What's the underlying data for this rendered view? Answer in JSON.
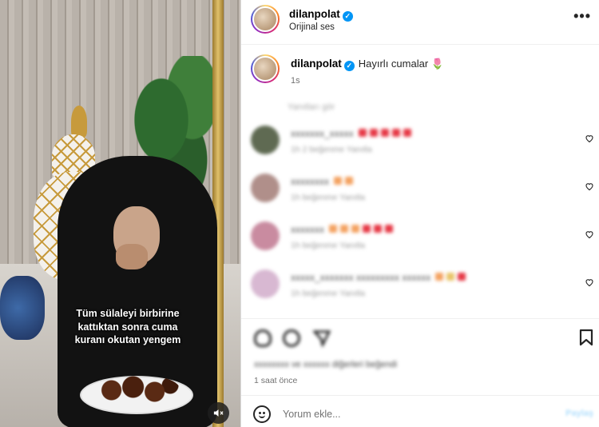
{
  "video": {
    "caption_lines": [
      "Tüm sülaleyi birbirine",
      "kattıktan sonra cuma",
      "kuranı okutan yengem"
    ],
    "mute_icon": "speaker-muted-icon"
  },
  "header": {
    "username": "dilanpolat",
    "verified_icon": "verified-badge-icon",
    "audio_label": "Orijinal ses",
    "more_icon": "more-options-icon",
    "more_glyph": "•••"
  },
  "caption": {
    "username": "dilanpolat",
    "text": "Hayırlı cumalar",
    "emoji": "🌷",
    "time": "1s"
  },
  "comments_blurred": {
    "hidden_label": "Yanıtları gör",
    "items": [
      {
        "name": "xxxxxxx_xxxxx",
        "meta": "1h  2 beğenme  Yanıtla",
        "avatar_color": "#5f6a52",
        "emoji_colors": [
          "#e63946",
          "#e63946",
          "#e63946",
          "#e63946",
          "#e63946"
        ]
      },
      {
        "name": "xxxxxxxx",
        "meta": "1h  beğenme  Yanıtla",
        "avatar_color": "#b08f8a",
        "emoji_colors": [
          "#f4a261",
          "#f4a261"
        ]
      },
      {
        "name": "xxxxxxx",
        "meta": "1h  beğenme  Yanıtla",
        "avatar_color": "#c98ba0",
        "emoji_colors": [
          "#f4a261",
          "#f4a261",
          "#f4a261",
          "#e63946",
          "#e63946",
          "#e63946"
        ]
      },
      {
        "name": "xxxxx_xxxxxxx xxxxxxxxx xxxxxx",
        "meta": "1h  beğenme  Yanıtla",
        "avatar_color": "#d8b8d2",
        "emoji_colors": [
          "#f4a261",
          "#e9c46a",
          "#e63946"
        ]
      }
    ]
  },
  "actions": {
    "like_icon": "heart-icon",
    "comment_icon": "comment-icon",
    "share_icon": "share-icon",
    "save_icon": "bookmark-icon"
  },
  "likes_text": "xxxxxxxx ve xxxxxx diğerleri beğendi",
  "post_time": "1 saat önce",
  "comment_bar": {
    "emoji_icon": "emoji-smile-icon",
    "placeholder": "Yorum ekle...",
    "post_label": "Paylaş"
  },
  "colors": {
    "verified": "#0095f6",
    "muted_text": "#737373",
    "post_button": "#b2dffc"
  }
}
